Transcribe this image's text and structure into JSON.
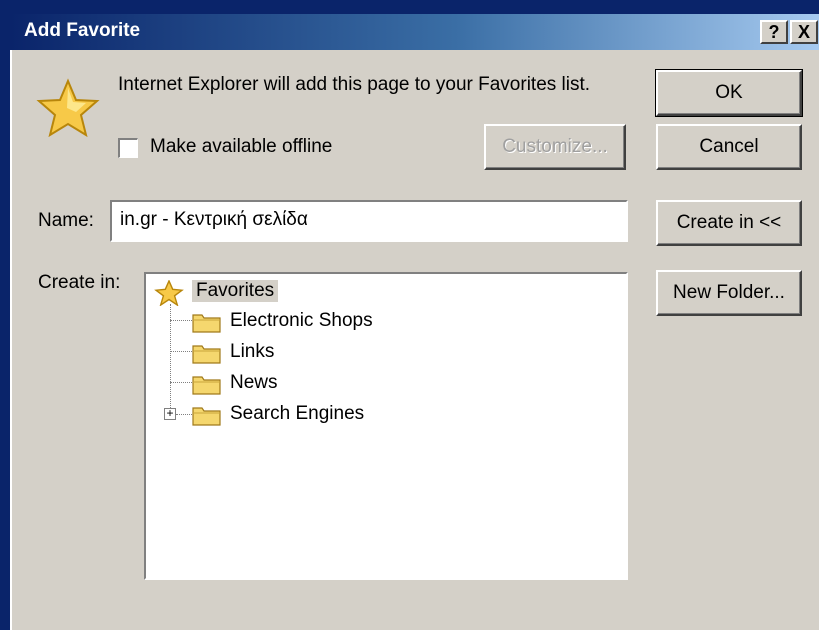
{
  "window": {
    "title": "Add Favorite",
    "help_label": "?",
    "close_label": "X"
  },
  "message": "Internet Explorer will add this page to your Favorites list.",
  "offline": {
    "label": "Make available offline",
    "checked": false
  },
  "buttons": {
    "ok": "OK",
    "cancel": "Cancel",
    "customize": "Customize...",
    "create_in": "Create in <<",
    "new_folder": "New Folder..."
  },
  "name": {
    "label": "Name:",
    "value": "in.gr - Κεντρική σελίδα"
  },
  "create_in": {
    "label": "Create in:",
    "root": "Favorites",
    "folders": [
      {
        "label": "Electronic Shops"
      },
      {
        "label": "Links"
      },
      {
        "label": "News"
      },
      {
        "label": "Search Engines",
        "expandable": true
      }
    ]
  },
  "colors": {
    "title_start": "#0a246a",
    "title_end": "#a6caf0",
    "dialog_face": "#d4d0c8",
    "folder_yellow": "#f5d76e",
    "star_gold": "#f7c948"
  },
  "icons": {
    "star": "star-icon",
    "folder": "folder-icon"
  }
}
